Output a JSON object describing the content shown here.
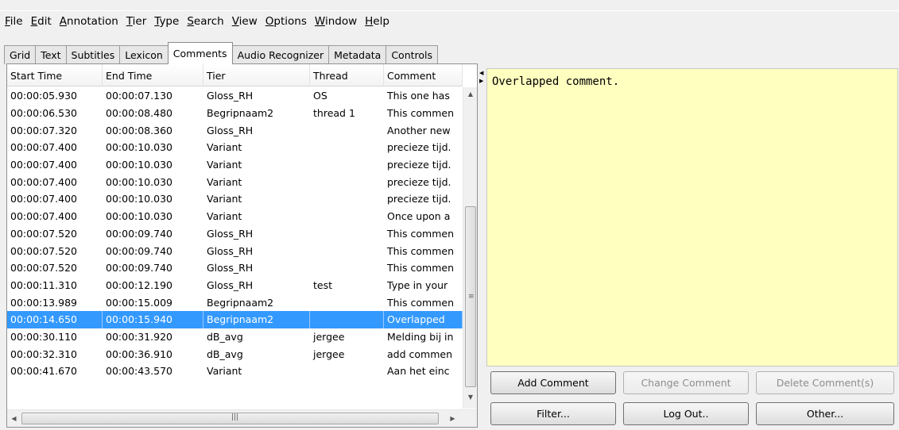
{
  "menu": [
    {
      "key": "F",
      "rest": "ile"
    },
    {
      "key": "E",
      "rest": "dit"
    },
    {
      "key": "A",
      "rest": "nnotation"
    },
    {
      "key": "T",
      "rest": "ier"
    },
    {
      "key": "T",
      "rest": "ype"
    },
    {
      "key": "S",
      "rest": "earch"
    },
    {
      "key": "V",
      "rest": "iew"
    },
    {
      "key": "O",
      "rest": "ptions"
    },
    {
      "key": "W",
      "rest": "indow"
    },
    {
      "key": "H",
      "rest": "elp"
    }
  ],
  "tabs": [
    "Grid",
    "Text",
    "Subtitles",
    "Lexicon",
    "Comments",
    "Audio Recognizer",
    "Metadata",
    "Controls"
  ],
  "active_tab": "Comments",
  "table": {
    "columns": [
      "Start Time",
      "End Time",
      "Tier",
      "Thread",
      "Comment"
    ],
    "rows": [
      [
        "00:00:05.930",
        "00:00:07.130",
        "Gloss_RH",
        "OS",
        "This one has"
      ],
      [
        "00:00:06.530",
        "00:00:08.480",
        "Begripnaam2",
        "thread 1",
        "This commen"
      ],
      [
        "00:00:07.320",
        "00:00:08.360",
        "Gloss_RH",
        "",
        "Another new"
      ],
      [
        "00:00:07.400",
        "00:00:10.030",
        "Variant",
        "",
        "precieze tijd."
      ],
      [
        "00:00:07.400",
        "00:00:10.030",
        "Variant",
        "",
        "precieze tijd."
      ],
      [
        "00:00:07.400",
        "00:00:10.030",
        "Variant",
        "",
        "precieze tijd."
      ],
      [
        "00:00:07.400",
        "00:00:10.030",
        "Variant",
        "",
        "precieze tijd."
      ],
      [
        "00:00:07.400",
        "00:00:10.030",
        "Variant",
        "",
        "Once upon a"
      ],
      [
        "00:00:07.520",
        "00:00:09.740",
        "Gloss_RH",
        "",
        "This commen"
      ],
      [
        "00:00:07.520",
        "00:00:09.740",
        "Gloss_RH",
        "",
        "This commen"
      ],
      [
        "00:00:07.520",
        "00:00:09.740",
        "Gloss_RH",
        "",
        "This commen"
      ],
      [
        "00:00:11.310",
        "00:00:12.190",
        "Gloss_RH",
        "test",
        "Type in your"
      ],
      [
        "00:00:13.989",
        "00:00:15.009",
        "Begripnaam2",
        "",
        "This commen"
      ],
      [
        "00:00:14.650",
        "00:00:15.940",
        "Begripnaam2",
        "",
        "Overlapped"
      ],
      [
        "00:00:30.110",
        "00:00:31.920",
        "dB_avg",
        "jergee",
        "Melding bij in"
      ],
      [
        "00:00:32.310",
        "00:00:36.910",
        "dB_avg",
        "jergee",
        "add commen"
      ],
      [
        "00:00:41.670",
        "00:00:43.570",
        "Variant",
        "",
        "Aan het einc"
      ]
    ],
    "selected_row": 13
  },
  "comment_text": "Overlapped comment.",
  "buttons": {
    "add": "Add Comment",
    "change": "Change Comment",
    "delete": "Delete Comment(s)",
    "filter": "Filter...",
    "logout": "Log Out..",
    "other": "Other..."
  },
  "colors": {
    "selection": "#3399ff",
    "comment_background": "#ffffc0"
  }
}
